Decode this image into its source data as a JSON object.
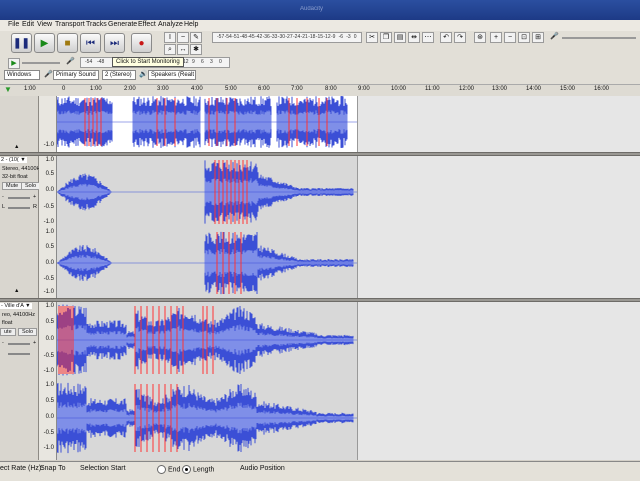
{
  "window_title": "Audacity",
  "menu": {
    "file": "File",
    "edit": "Edit",
    "view": "View",
    "transport": "Transport",
    "tracks": "Tracks",
    "generate": "Generate",
    "effect": "Effect",
    "analyze": "Analyze",
    "help": "Help"
  },
  "meter_scale": [
    "-57",
    "-54",
    "-51",
    "-48",
    "-45",
    "-42",
    "-36",
    "-33",
    "-30",
    "-27",
    "-24",
    "-21",
    "-18",
    "-15",
    "-12",
    "-9",
    "-6",
    "-3",
    "0"
  ],
  "record_meter_scale": [
    "-54",
    "-48"
  ],
  "monitor_tooltip": "Click to Start Monitoring",
  "rec_meter_tail": [
    "12",
    "9",
    "6",
    "3",
    "0"
  ],
  "devices": {
    "host": "Windows",
    "input": "Primary Sound",
    "channels": "2 (Stereo)",
    "output": "Speakers (Realt"
  },
  "ruler": [
    "1:00",
    "0",
    "1:00",
    "2:00",
    "3:00",
    "4:00",
    "5:00",
    "6:00",
    "7:00",
    "8:00",
    "9:00",
    "10:00",
    "11:00",
    "12:00",
    "13:00",
    "14:00",
    "15:00",
    "16:00"
  ],
  "track2": {
    "name": "2 - (10( ▼",
    "info1": "Stereo, 44100Hz",
    "info2": "32-bit float",
    "mute": "Mute",
    "solo": "Solo",
    "minus": "-",
    "plus": "+",
    "L": "L",
    "R": "R"
  },
  "track3": {
    "name": "- Ville d'A ▼",
    "info1": "reo, 44100Hz",
    "info2": "float",
    "mute": "ute",
    "solo": "Solo",
    "minus": "-",
    "plus": "+"
  },
  "scale_labels": {
    "top": "1.0",
    "q1": "0.5",
    "mid": "0.0",
    "q3": "-0.5",
    "bot": "-1.0",
    "top1": "1.0",
    "q1b": "0.5",
    "midb": "0.0",
    "q3b": "-0.5",
    "botb": "-1.0"
  },
  "bottom": {
    "rate": "ect Rate (Hz):",
    "snap": "Snap To",
    "selection_start": "Selection Start",
    "end": "End",
    "length": "Length",
    "audio_position": "Audio Position"
  },
  "colors": {
    "wave": "#3b4fd6",
    "wave_light": "#7f8fe8",
    "clip_marks": "#ff3333"
  }
}
